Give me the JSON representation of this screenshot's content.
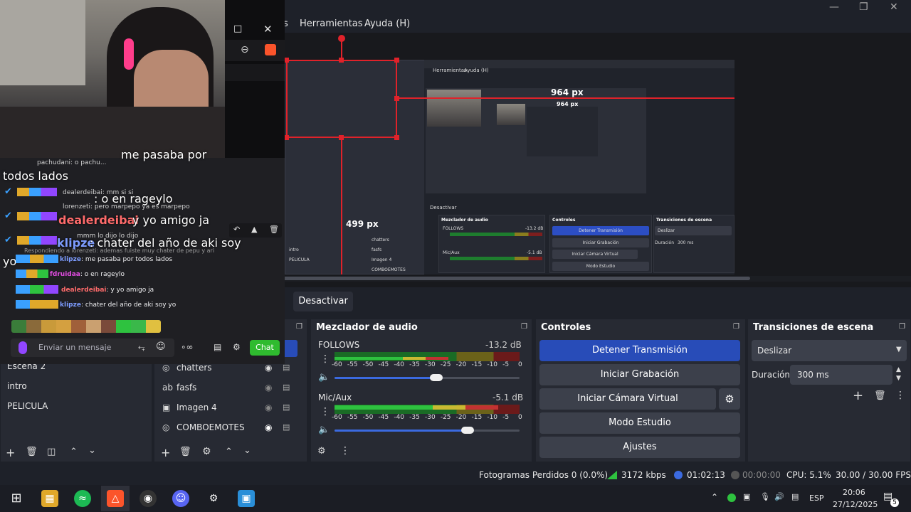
{
  "window": {
    "menu": [
      "Herramientas",
      "Ayuda (H)"
    ],
    "partial_menu": "s"
  },
  "preview": {
    "px_top": "964 px",
    "px_inner": "964 px",
    "px_left": "499 px",
    "inner_menu": [
      "Herramientas",
      "Ayuda (H)"
    ],
    "inner_docks": {
      "mixer_title": "Mezclador de audio",
      "follows": "FOLLOWS",
      "follows_db": "-13.2 dB",
      "micaux": "Mic/Aux",
      "micaux_db": "-5.1 dB",
      "controls_title": "Controles",
      "ctrl_buttons": [
        "Detener Transmisión",
        "Iniciar Grabación",
        "Iniciar Cámara Virtual",
        "Modo Estudio"
      ],
      "transitions_title": "Transiciones de escena",
      "transition": "Deslizar",
      "duration_label": "Duración",
      "duration": "300 ms",
      "sources": [
        "chatters",
        "fasfs",
        "Imagen 4",
        "COMBOEMOTES"
      ],
      "scenes": [
        "intro",
        "PELICULA"
      ],
      "deactivate": "Desactivar"
    }
  },
  "deactivate_label": "Desactivar",
  "scenes": {
    "items": [
      "Escena 2",
      "intro",
      "PELICULA"
    ]
  },
  "sources": {
    "items": [
      "chatters",
      "fasfs",
      "Imagen 4",
      "COMBOEMOTES"
    ]
  },
  "mixer": {
    "title": "Mezclador de audio",
    "channels": [
      {
        "name": "FOLLOWS",
        "db": "-13.2 dB",
        "volume": 0.55
      },
      {
        "name": "Mic/Aux",
        "db": "-5.1 dB",
        "volume": 0.72
      }
    ],
    "ticks": [
      "-60",
      "-55",
      "-50",
      "-45",
      "-40",
      "-35",
      "-30",
      "-25",
      "-20",
      "-15",
      "-10",
      "-5",
      "0"
    ]
  },
  "controls": {
    "title": "Controles",
    "stop_stream": "Detener Transmisión",
    "start_recording": "Iniciar Grabación",
    "start_virtual_cam": "Iniciar Cámara Virtual",
    "studio_mode": "Modo Estudio",
    "settings": "Ajustes"
  },
  "transitions": {
    "title": "Transiciones de escena",
    "selected": "Deslizar",
    "duration_label": "Duración",
    "duration_value": "300 ms"
  },
  "status": {
    "dropped_frames": "Fotogramas Perdidos 0 (0.0%)",
    "bitrate": "3172 kbps",
    "stream_time": "01:02:13",
    "record_time": "00:00:00",
    "cpu": "CPU: 5.1%",
    "fps": "30.00 / 30.00 FPS"
  },
  "taskbar": {
    "lang": "ESP",
    "time": "20:06",
    "date": "27/12/2025",
    "notifications": "5"
  },
  "chat": {
    "top_cut": "me pasaba por",
    "big_lines": [
      "todos lados",
      ": o en rageylo",
      "y yo amigo ja",
      ": chater del año de aki soy",
      "yo"
    ],
    "big_users": [
      "dealerdeibai",
      "klipze"
    ],
    "small_messages": [
      {
        "user": "klipze",
        "text": ": me pasaba por todos lados",
        "color": "#7d9cff"
      },
      {
        "user": "fdruidaa",
        "text": ": o en rageylo",
        "color": "#e04ce0"
      },
      {
        "user": "dealerdeibai",
        "text": ": y yo amigo ja",
        "color": "#ff6b6b"
      },
      {
        "user": "klipze",
        "text": ": chater del año de aki soy yo",
        "color": "#7d9cff"
      }
    ],
    "overlap_lines": [
      "pachudani: o pachu...",
      "dealerdeibai: mm si si",
      "lorenzeti: pero marpepo ya es marpepo",
      "mmm lo dijo lo dijo"
    ],
    "reply_note": "Respondiendo a lorenzeti: ademas fuiste muy chater de pepu y ari",
    "input_placeholder": "Enviar un mensaje",
    "send_label": "Chat"
  }
}
